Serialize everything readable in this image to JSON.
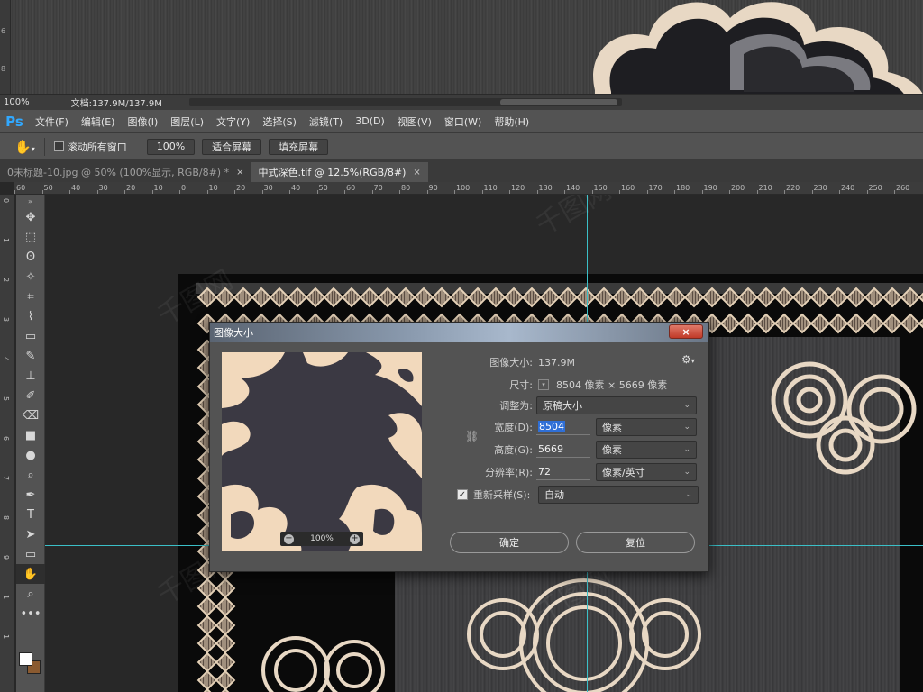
{
  "prev_document": {
    "zoom": "100%",
    "doc_info": "文档:137.9M/137.9M",
    "scroll_arrow": "‹",
    "ruler_marks": [
      "6",
      "8"
    ]
  },
  "menubar": {
    "logo": "Ps",
    "items": [
      "文件(F)",
      "编辑(E)",
      "图像(I)",
      "图层(L)",
      "文字(Y)",
      "选择(S)",
      "滤镜(T)",
      "3D(D)",
      "视图(V)",
      "窗口(W)",
      "帮助(H)"
    ]
  },
  "options": {
    "hand_icon": "hand-icon",
    "scroll_all_label": "滚动所有窗口",
    "zoom_value": "100%",
    "fit_screen_label": "适合屏幕",
    "fill_screen_label": "填充屏幕"
  },
  "tabs": [
    {
      "label": "0未标题-10.jpg @ 50% (100%显示, RGB/8#) *",
      "close": "×",
      "active": false
    },
    {
      "label": "中式深色.tif @ 12.5%(RGB/8#)",
      "close": "×",
      "active": true
    }
  ],
  "ruler": {
    "h_ticks": [
      "60",
      "50",
      "40",
      "30",
      "20",
      "10",
      "0",
      "10",
      "20",
      "30",
      "40",
      "50",
      "60",
      "70",
      "80",
      "90",
      "100",
      "110",
      "120",
      "130",
      "140",
      "150",
      "160",
      "170",
      "180",
      "190",
      "200",
      "210",
      "220",
      "230",
      "240",
      "250",
      "260"
    ],
    "v_ticks": [
      "0",
      "1",
      "2",
      "3",
      "4",
      "5",
      "6",
      "7",
      "8",
      "9",
      "1",
      "1"
    ]
  },
  "toolbar": {
    "collapse": "»",
    "tools": [
      "move-tool",
      "marquee-tool",
      "lasso-tool",
      "magic-wand-tool",
      "crop-tool",
      "eyedropper-tool",
      "healing-brush-tool",
      "brush-tool",
      "clone-stamp-tool",
      "history-brush-tool",
      "eraser-tool",
      "gradient-tool",
      "blur-tool",
      "dodge-tool",
      "pen-tool",
      "type-tool",
      "path-selection-tool",
      "rectangle-tool",
      "hand-tool",
      "zoom-tool",
      "more-tools"
    ],
    "glyphs": [
      "✥",
      "⬚",
      "ʘ",
      "✧",
      "⌗",
      "⌇",
      "▭",
      "✎",
      "⊥",
      "✐",
      "⌫",
      "■",
      "●",
      "⌕",
      "✒",
      "T",
      "➤",
      "▭",
      "✋",
      "⌕",
      "•••"
    ],
    "foreground_color": "#ffffff",
    "background_color": "#8a5a30"
  },
  "dialog": {
    "title": "图像大小",
    "close": "×",
    "image_size_label": "图像大小:",
    "image_size_value": "137.9M",
    "dimensions_label": "尺寸:",
    "dimensions_value": "8504 像素 × 5669 像素",
    "fit_to_label": "调整为:",
    "fit_to_value": "原稿大小",
    "width_label": "宽度(D):",
    "width_value": "8504",
    "width_unit": "像素",
    "height_label": "高度(G):",
    "height_value": "5669",
    "height_unit": "像素",
    "resolution_label": "分辨率(R):",
    "resolution_value": "72",
    "resolution_unit": "像素/英寸",
    "resample_label": "重新采样(S):",
    "resample_checked": true,
    "resample_value": "自动",
    "preview_zoom": "100%",
    "zoom_out": "−",
    "zoom_in": "+",
    "ok_label": "确定",
    "reset_label": "复位"
  },
  "colors": {
    "ui_dark": "#535353",
    "canvas_bg": "#282828",
    "guide": "#3bc0c8",
    "ps_blue": "#31a8ff",
    "cream": "#f2d9bc",
    "preview_bg": "#3b3943"
  },
  "watermark": "千图网"
}
